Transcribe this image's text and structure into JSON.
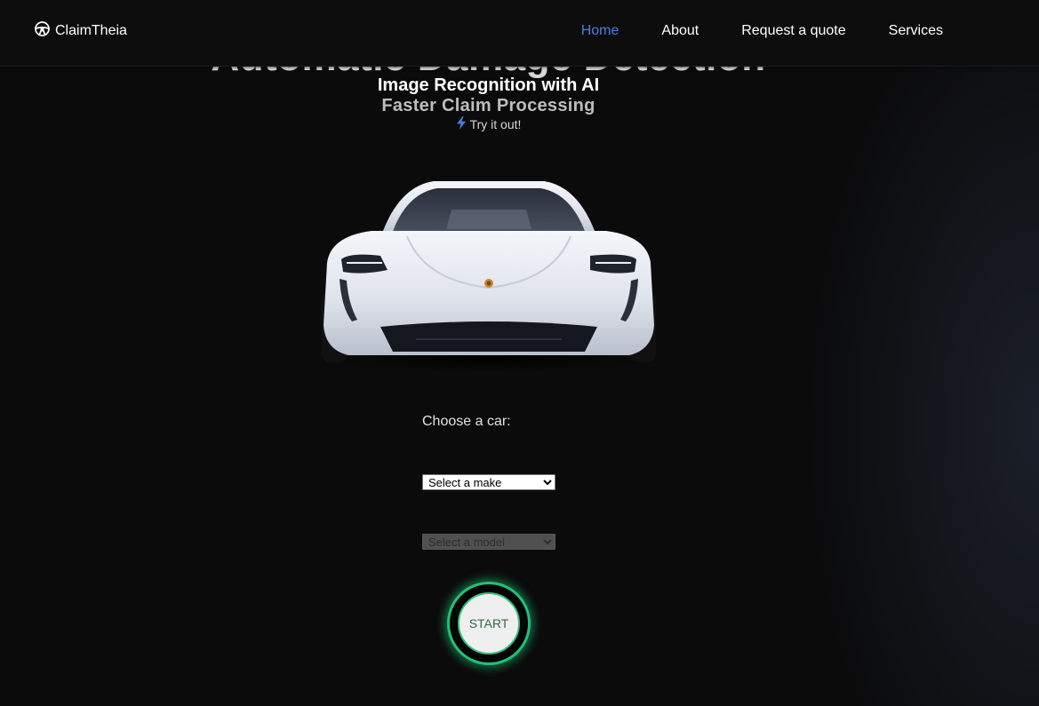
{
  "nav": {
    "brand": "ClaimTheia",
    "links": [
      {
        "label": "Home",
        "active": true
      },
      {
        "label": "About",
        "active": false
      },
      {
        "label": "Request a quote",
        "active": false
      },
      {
        "label": "Services",
        "active": false
      }
    ]
  },
  "hero": {
    "title_hidden": "Automatic Damage Detection",
    "title": "Image Recognition with AI",
    "subtitle": "Faster Claim Processing",
    "cta": "Try it out!"
  },
  "form": {
    "choose_label": "Choose a car:",
    "make_placeholder": "Select a make",
    "model_placeholder": "Select a model",
    "start_label": "START"
  },
  "colors": {
    "background": "#0b0b0c",
    "nav_active": "#4a7ee0",
    "accent_green": "#22c07a"
  },
  "icons": {
    "brand": "steering-wheel-icon",
    "cta": "lightning-bolt-icon"
  }
}
